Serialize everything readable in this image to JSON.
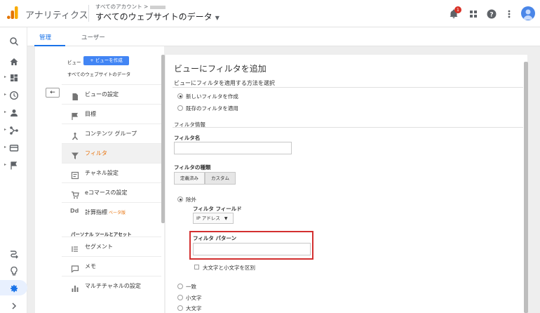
{
  "header": {
    "app_name": "アナリティクス",
    "breadcrumb": "すべてのアカウント >",
    "property": "すべてのウェブサイトのデータ",
    "notification_count": "1",
    "colors": {
      "logo_orange": "#f9ab00",
      "logo_dark": "#e37400",
      "accent": "#1a73e8",
      "badge": "#d93025"
    }
  },
  "tabs": [
    {
      "label": "管理",
      "active": true
    },
    {
      "label": "ユーザー",
      "active": false
    }
  ],
  "rail_icons": [
    "search-icon",
    "home-icon",
    "dashboard-icon",
    "clock-icon",
    "person-icon",
    "acquisition-icon",
    "behavior-icon",
    "flag-icon",
    "attribution-icon",
    "lightbulb-icon",
    "gear-icon",
    "chevron-right-icon"
  ],
  "view": {
    "label": "ビュー",
    "create_button": "+ ビューを作成",
    "name": "すべてのウェブサイトのデータ"
  },
  "nav_items": [
    {
      "label": "ビューの設定",
      "icon": "document-icon",
      "active": false
    },
    {
      "label": "目標",
      "icon": "flag-icon",
      "active": false
    },
    {
      "label": "コンテンツ グループ",
      "icon": "content-group-icon",
      "active": false
    },
    {
      "label": "フィルタ",
      "icon": "filter-icon",
      "active": true
    },
    {
      "label": "チャネル設定",
      "icon": "channel-icon",
      "active": false
    },
    {
      "label": "eコマースの設定",
      "icon": "cart-icon",
      "active": false
    },
    {
      "label": "計算指標",
      "icon": "dd-icon",
      "active": false,
      "badge": "ベータ版"
    },
    {
      "label": "セグメント",
      "icon": "segment-icon",
      "active": false
    },
    {
      "label": "メモ",
      "icon": "memo-icon",
      "active": false
    },
    {
      "label": "マルチチャネルの設定",
      "icon": "bar-chart-icon",
      "active": false
    }
  ],
  "section_header": "パーソナル ツールとアセット",
  "copyright": "©",
  "main": {
    "title": "ビューにフィルタを追加",
    "method_heading": "ビューにフィルタを適用する方法を選択",
    "method_options": [
      {
        "label": "新しいフィルタを作成",
        "selected": true
      },
      {
        "label": "既存のフィルタを適用",
        "selected": false
      }
    ],
    "filter_info": "フィルタ情報",
    "filter_name_label": "フィルタ名",
    "filter_name_value": "",
    "filter_type_label": "フィルタの種類",
    "type_buttons": [
      "定義済み",
      "カスタム"
    ],
    "exclude_label": "除外",
    "filter_field_label": "フィルタ フィールド",
    "filter_field_value": "IP アドレス",
    "filter_pattern_label": "フィルタ パターン",
    "filter_pattern_value": "",
    "case_sensitive_label": "大文字と小文字を区別",
    "case_options": [
      "一致",
      "小文字",
      "大文字"
    ]
  }
}
